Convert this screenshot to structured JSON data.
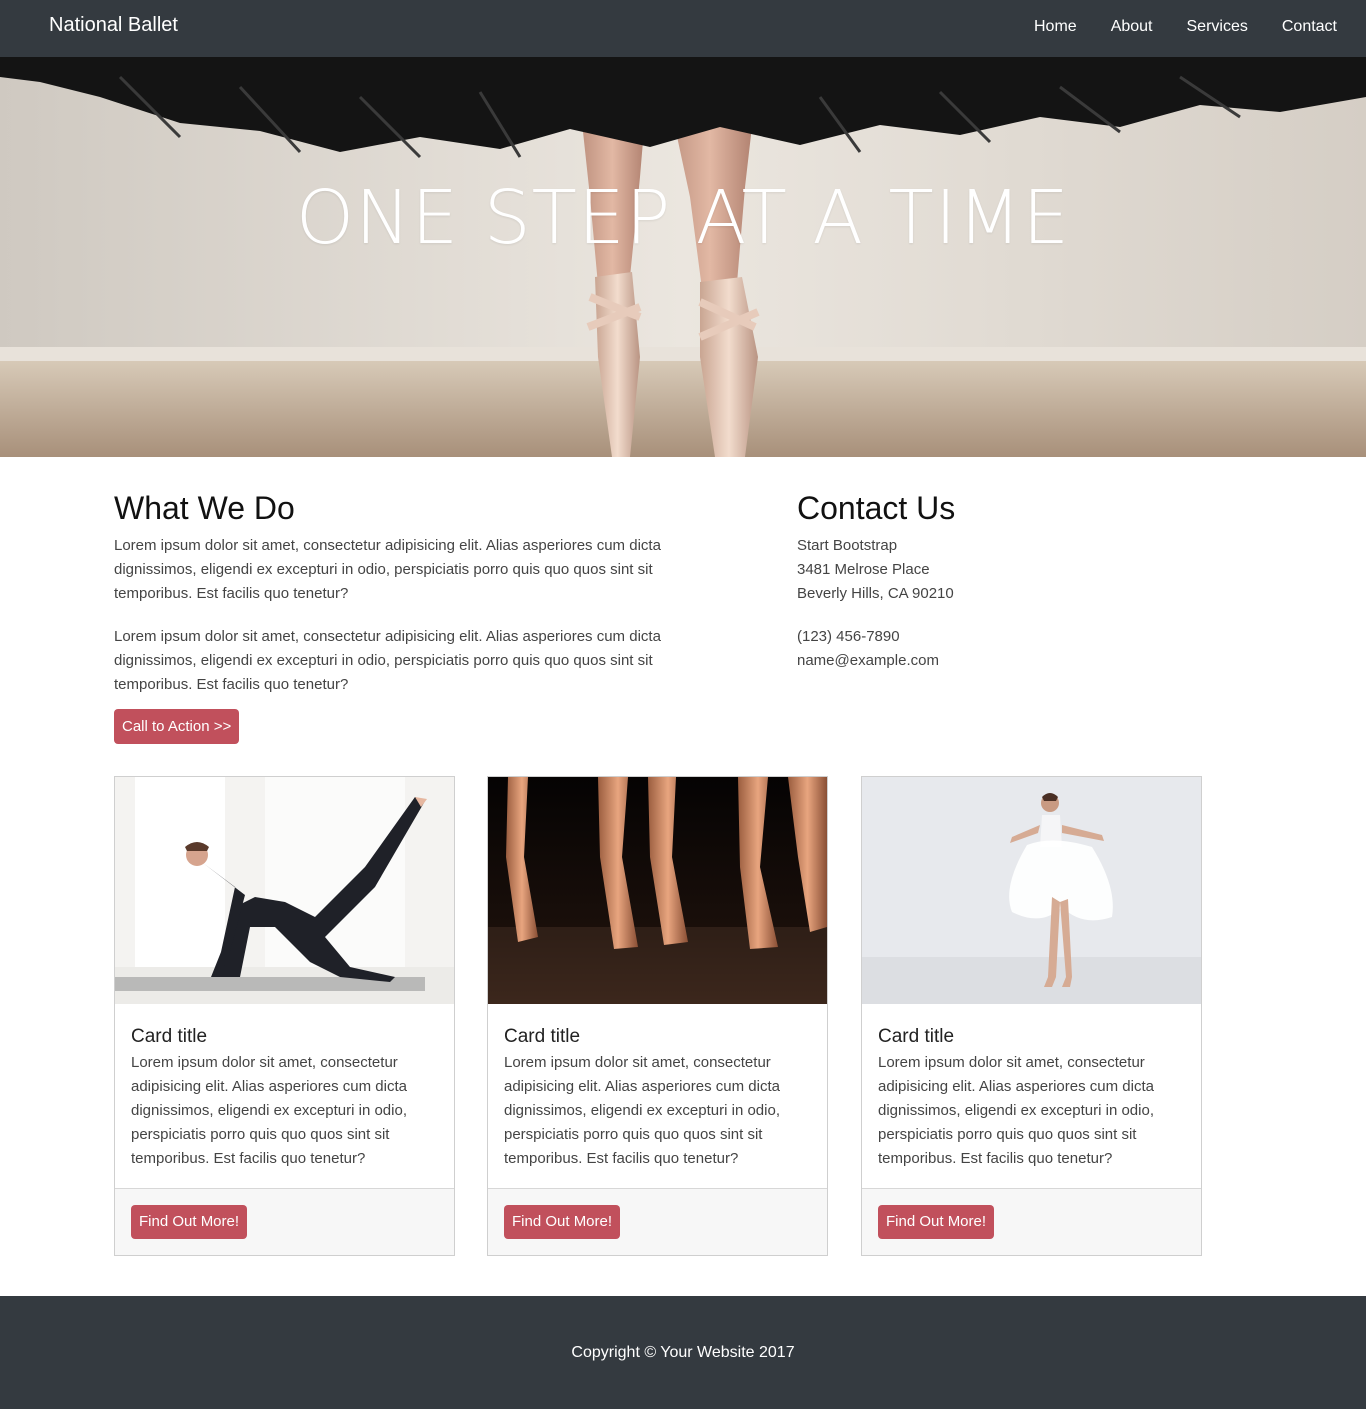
{
  "navbar": {
    "brand": "National Ballet",
    "links": [
      "Home",
      "About",
      "Services",
      "Contact"
    ]
  },
  "hero": {
    "title": "ONE STEP AT A TIME",
    "image": "ballet-pointe-shoes-tutu-photo"
  },
  "what_we_do": {
    "heading": "What We Do",
    "paragraphs": [
      "Lorem ipsum dolor sit amet, consectetur adipisicing elit. Alias asperiores cum dicta dignissimos, eligendi ex excepturi in odio, perspiciatis porro quis quo quos sint sit temporibus. Est facilis quo tenetur?",
      "Lorem ipsum dolor sit amet, consectetur adipisicing elit. Alias asperiores cum dicta dignissimos, eligendi ex excepturi in odio, perspiciatis porro quis quo quos sint sit temporibus. Est facilis quo tenetur?"
    ],
    "cta_label": "Call to Action >>"
  },
  "contact": {
    "heading": "Contact Us",
    "name": "Start Bootstrap",
    "street": "3481 Melrose Place",
    "city": "Beverly Hills, CA 90210",
    "phone": "(123) 456-7890",
    "email": "name@example.com"
  },
  "cards": [
    {
      "image": "ballerina-stretching-photo",
      "title": "Card title",
      "text": "Lorem ipsum dolor sit amet, consectetur adipisicing elit. Alias asperiores cum dicta dignissimos, eligendi ex excepturi in odio, perspiciatis porro quis quo quos sint sit temporibus. Est facilis quo tenetur?",
      "button": "Find Out More!"
    },
    {
      "image": "pointe-shoes-stage-photo",
      "title": "Card title",
      "text": "Lorem ipsum dolor sit amet, consectetur adipisicing elit. Alias asperiores cum dicta dignissimos, eligendi ex excepturi in odio, perspiciatis porro quis quo quos sint sit temporibus. Est facilis quo tenetur?",
      "button": "Find Out More!"
    },
    {
      "image": "ballerina-white-dress-photo",
      "title": "Card title",
      "text": "Lorem ipsum dolor sit amet, consectetur adipisicing elit. Alias asperiores cum dicta dignissimos, eligendi ex excepturi in odio, perspiciatis porro quis quo quos sint sit temporibus. Est facilis quo tenetur?",
      "button": "Find Out More!"
    }
  ],
  "footer": {
    "copyright": "Copyright © Your Website 2017"
  },
  "colors": {
    "navbar": "#343a40",
    "button": "#c1505c",
    "card_footer": "#f7f7f7"
  }
}
